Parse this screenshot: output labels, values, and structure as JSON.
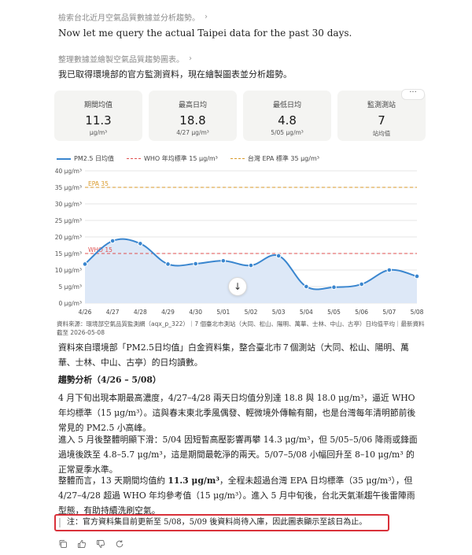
{
  "steps": {
    "step1": "檢索台北近月空氣品質數據並分析趨勢。",
    "msg1": "Now let me query the actual Taipei data for the past 30 days.",
    "step2": "整理數據並繪製空氣品質趨勢圖表。",
    "msg2": "我已取得環境部的官方監測資料，現在繪製圖表並分析趨勢。"
  },
  "cards": [
    {
      "label": "期間均值",
      "value": "11.3",
      "sub": "μg/m³"
    },
    {
      "label": "最高日均",
      "value": "18.8",
      "sub": "4/27 μg/m³"
    },
    {
      "label": "最低日均",
      "value": "4.8",
      "sub": "5/05 μg/m³"
    },
    {
      "label": "監測測站",
      "value": "7",
      "sub": "站均值"
    }
  ],
  "more_label": "···",
  "chart_data": {
    "type": "line",
    "categories": [
      "4/26",
      "4/27",
      "4/28",
      "4/29",
      "4/30",
      "5/01",
      "5/02",
      "5/03",
      "5/04",
      "5/05",
      "5/06",
      "5/07",
      "5/08"
    ],
    "series": [
      {
        "name": "PM2.5 日均值",
        "color": "#3a86cf",
        "values": [
          11.8,
          18.8,
          18.0,
          11.8,
          11.9,
          12.8,
          11.4,
          14.3,
          5.0,
          4.8,
          5.7,
          10.0,
          8.1
        ]
      }
    ],
    "reference_lines": [
      {
        "name": "WHO 年均標準 15 μg/m³",
        "label": "WHO 15",
        "value": 15,
        "color": "#e05050"
      },
      {
        "name": "台灣 EPA 標準 35 μg/m³",
        "label": "EPA 35",
        "value": 35,
        "color": "#d99a2b"
      }
    ],
    "y_ticks": [
      "0 μg/m³",
      "5 μg/m³",
      "10 μg/m³",
      "15 μg/m³",
      "20 μg/m³",
      "25 μg/m³",
      "30 μg/m³",
      "35 μg/m³",
      "40 μg/m³"
    ],
    "ylim": [
      0,
      40
    ],
    "grid": true,
    "legend": "top-left",
    "area_fill": "#dde8f7"
  },
  "source_text": "資料來源：環境部空氣品質監測網（aqx_p_322）｜7 個臺北市測站（大同、松山、陽明、萬華、士林、中山、古亭）日均值平均｜最新資料截至 2026-05-08",
  "body": {
    "p1": "資料來自環境部「PM2.5日均值」白金資料集，整合臺北市７個測站（大同、松山、陽明、萬華、士林、中山、古亭）的日均讀數。",
    "section": "趨勢分析（4/26 – 5/08）",
    "p2": "4 月下旬出現本期最高濃度，4/27–4/28 兩天日均值分別達 18.8 與 18.0 μg/m³，逼近 WHO 年均標準（15 μg/m³）。這與春末東北季風偶發、輕微境外傳輸有關，也是台灣每年清明節前後常見的 PM2.5 小高峰。",
    "p3": "進入 5 月後整體明顯下滑：5/04 因短暫高壓影響再攀 14.3 μg/m³，但 5/05–5/06 降雨或鋒面過境後跌至 4.8–5.7 μg/m³，這是期間最乾淨的兩天。5/07–5/08 小幅回升至 8–10 μg/m³ 的正常夏季水準。",
    "p4_a": "整體而言，13 天期間均值約 ",
    "p4_b": "11.3 μg/m³",
    "p4_c": "，全程未超過台灣 EPA 日均標準（35 μg/m³），但 4/27–4/28 超過 WHO 年均參考值（15 μg/m³）。進入 5 月中旬後，台北天氣漸趨午後雷陣雨型態，有助持續洗刷空氣。",
    "note": "注：官方資料集目前更新至 5/08，5/09 後資料尚待入庫，因此圖表顯示至該日為止。"
  }
}
